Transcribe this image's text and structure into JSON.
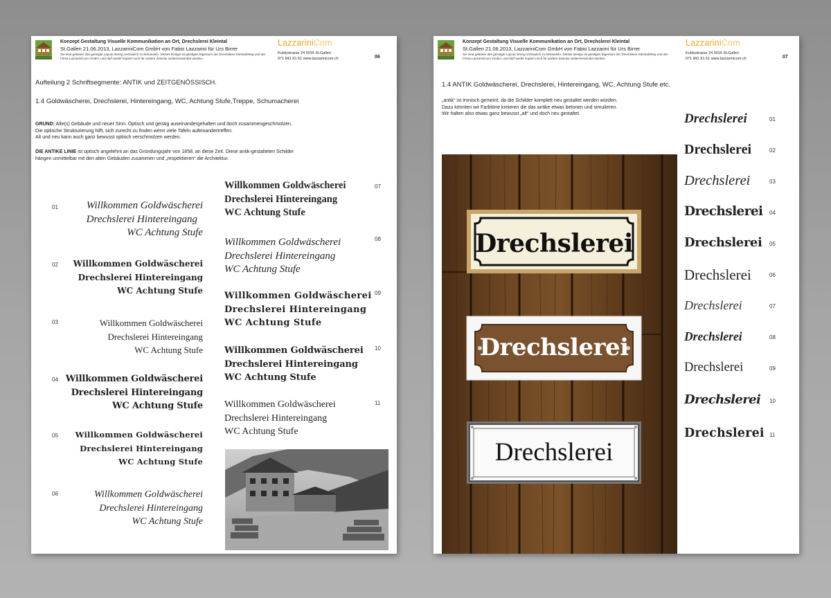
{
  "left": {
    "header": {
      "title": "Konzept Gestaltung Visuelle Kommunikation an Ort, Drechslerei Kleintal",
      "subtitle": "St.Gallen 21.06.2013, LazzariniCom GmbH von Fabio Lazzarini für Urs Birrer",
      "note": "Sie sind gebeten das gezeigte Layout streng vertraulich zu behandeln. Dieses Design ist geistiges Eigentum der Drechslerei Kleintal/Steg und der Firma LazzariniCom GmbH, und darf weder kopiert noch für andere Zwecke weiterverwendet werden.",
      "brand_a": "Lazzarini",
      "brand_b": "Com",
      "address_line1": "Kublystrasse 24   9016 St.Gallen",
      "address_line2": "071 841 61 61     www.lazzarinicom.ch",
      "page_number": "06"
    },
    "heading": "Aufteilung 2 Schriftsegmente: ANTIK und ZEITGENÖSSISCH.",
    "section_title": "1.4  Goldwäscherei, Drechslerei, Hintereingang, WC, Achtung Stufe,Treppe, Schumacherei",
    "grund_label": "GRUND:",
    "grund_text_1": " Alte(s) Gebäude und neuer Sinn. Optisch und geistig auseinandergehalten und doch zusammengeschmolzen.",
    "grund_text_2": "Die optische Strukturierung hilft, sich zurecht zu finden wenn viele Tafeln aufeinandertreffen.",
    "grund_text_3": "Alt und neu kann auch ganz bewusst optisch verschmolzen werden.",
    "antik_label": "DIE ANTIKE LINIE",
    "antik_text_1": " ist optisch angelehnt an das Gründungsjahr von 1858, an diese Zeit. Diese antik-gestalteten Schilder",
    "antik_text_2": "hängen unmittelbar mit den alten Gebäuden zusammen und „respektieren“ die Architektur.",
    "samples": [
      {
        "num": "01",
        "l1": "Willkommen Goldwäscherei",
        "l2": "Drechslerei Hintereingang",
        "l3": "WC Achtung Stufe"
      },
      {
        "num": "02",
        "l1": "Willkommen Goldwäscherei",
        "l2": "Drechslerei Hintereingang",
        "l3": "WC Achtung Stufe"
      },
      {
        "num": "03",
        "l1": "Willkommen Goldwäscherei",
        "l2": "Drechslerei Hintereingang",
        "l3": "WC Achtung Stufe"
      },
      {
        "num": "04",
        "l1": "Willkommen Goldwäscherei",
        "l2": "Drechslerei Hintereingang",
        "l3": "WC Achtung Stufe"
      },
      {
        "num": "05",
        "l1": "Willkommen Goldwäscherei",
        "l2": "Drechslerei Hintereingang",
        "l3": "WC Achtung Stufe"
      },
      {
        "num": "06",
        "l1": "Willkommen Goldwäscherei",
        "l2": "Drechslerei Hintereingang",
        "l3": "WC Achtung Stufe"
      },
      {
        "num": "07",
        "l1": "Willkommen Goldwäscherei",
        "l2": "Drechslerei Hintereingang",
        "l3": "WC Achtung Stufe"
      },
      {
        "num": "08",
        "l1": "Willkommen Goldwäscherei",
        "l2": "Drechslerei Hintereingang",
        "l3": "WC Achtung Stufe"
      },
      {
        "num": "09",
        "l1": "Willkommen Goldwäscherei",
        "l2": "Drechslerei Hintereingang",
        "l3": "WC Achtung Stufe"
      },
      {
        "num": "10",
        "l1": "Willkommen Goldwäscherei",
        "l2": "Drechslerei Hintereingang",
        "l3": "WC Achtung Stufe"
      },
      {
        "num": "11",
        "l1": "Willkommen Goldwäscherei",
        "l2": "Drechslerei Hintereingang",
        "l3": "WC Achtung Stufe"
      }
    ]
  },
  "right": {
    "header": {
      "title": "Konzept Gestaltung Visuelle Kommunikation an Ort, Drechslerei Kleintal",
      "subtitle": "St.Gallen 21.06.2013, LazzariniCom GmbH von Fabio Lazzarini für Urs Birrer",
      "note": "Sie sind gebeten das gezeigte Layout streng vertraulich zu behandeln. Dieses Design ist geistiges Eigentum der Drechslerei Kleintal/Steg und der Firma LazzariniCom GmbH, und darf weder kopiert noch für andere Zwecke weiterverwendet werden.",
      "brand_a": "Lazzarini",
      "brand_b": "Com",
      "address_line1": "Kublystrasse 24   9016 St.Gallen",
      "address_line2": "071 841 61 61     www.lazzarinicom.ch",
      "page_number": "07"
    },
    "section_title": "1.4 ANTIK Goldwäscherei, Drechslerei, Hintereingang, WC, Achtung Stufe etc.",
    "intro_1": "„antik“ ist ironisch gemeint, da die Schilder komplett neu gestaltet werden würden.",
    "intro_2": "Dazu könnten wir Farbtöne kreieren die das antike etwas betonen und simulieren.",
    "intro_3": "Wir halten also etwas ganz bewusst „alt“ und doch neu gestaltet.",
    "signs": [
      "Drechslerei",
      "Drechslerei",
      "Drechslerei"
    ],
    "variants": [
      {
        "num": "01",
        "text": "Drechslerei"
      },
      {
        "num": "02",
        "text": "Drechslerei"
      },
      {
        "num": "03",
        "text": "Drechslerei"
      },
      {
        "num": "04",
        "text": "Drechslerei"
      },
      {
        "num": "05",
        "text": "Drechslerei"
      },
      {
        "num": "06",
        "text": "Drechslerei"
      },
      {
        "num": "07",
        "text": "Drechslerei"
      },
      {
        "num": "08",
        "text": "Drechslerei"
      },
      {
        "num": "09",
        "text": "Drechslerei"
      },
      {
        "num": "10",
        "text": "Drechslerei"
      },
      {
        "num": "11",
        "text": "Drechslerei"
      }
    ]
  },
  "colors": {
    "brand": "#f0a31d",
    "wood": "#5a3a1e",
    "sign_brown": "#7a5230",
    "background": "#9a9a9a"
  }
}
